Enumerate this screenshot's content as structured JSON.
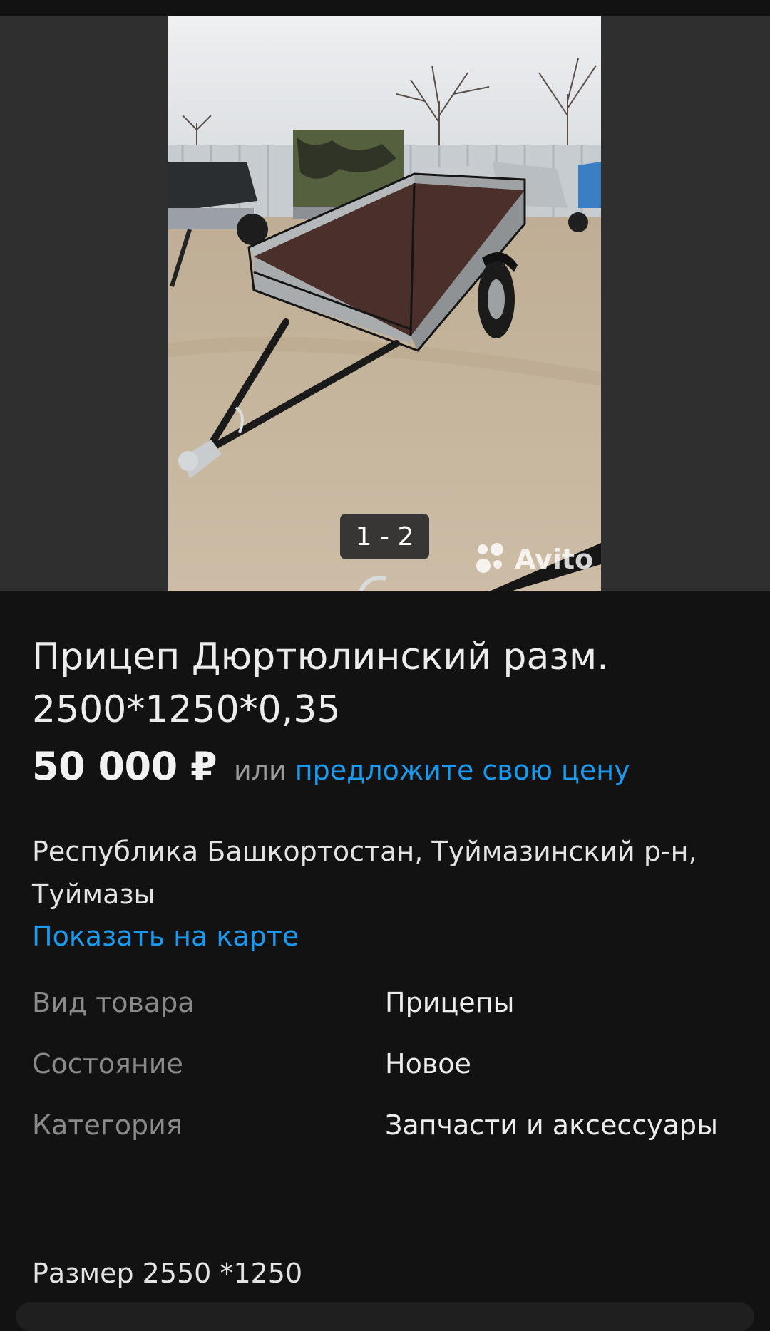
{
  "gallery": {
    "counter": "1 - 2",
    "watermark": "Avito",
    "photo_alt": "trailer-photo"
  },
  "listing": {
    "title": "Прицеп Дюртюлинский разм. 2500*1250*0,35",
    "price": "50 000 ₽",
    "price_or": "или",
    "price_offer": "предложите свою цену",
    "address": "Республика Башкортостан, Туймазинский р-н, Туймазы",
    "map_link": "Показать на карте",
    "params": [
      {
        "label": "Вид товара",
        "value": "Прицепы"
      },
      {
        "label": "Состояние",
        "value": "Новое"
      },
      {
        "label": "Категория",
        "value": "Запчасти и аксессуары"
      }
    ],
    "description": "Размер 2550 *1250"
  },
  "colors": {
    "background": "#121212",
    "gallery_bg": "#2f2f2f",
    "link": "#1a9bef",
    "muted": "#8a8a8a"
  }
}
